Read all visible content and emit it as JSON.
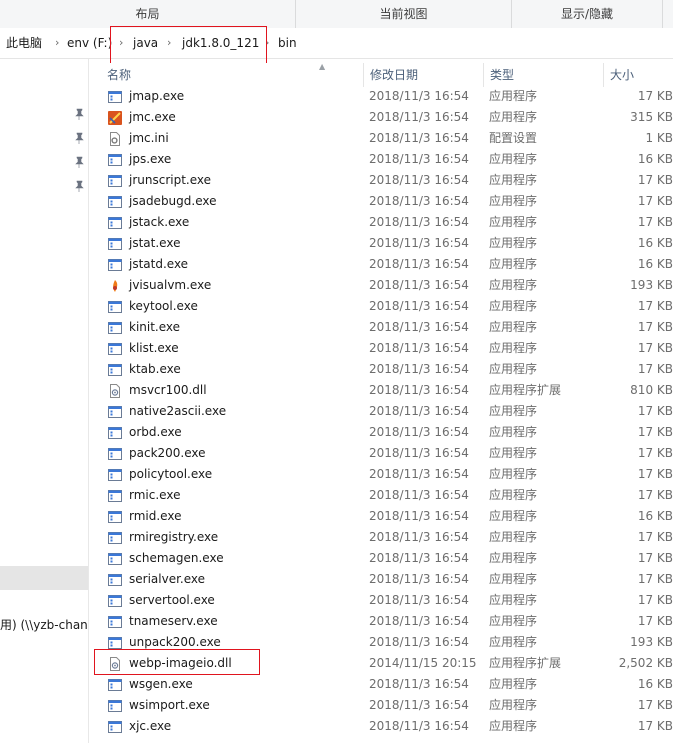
{
  "ribbon": {
    "sections": [
      "布局",
      "当前视图",
      "显示/隐藏"
    ]
  },
  "address": {
    "crumbs": [
      "此电脑",
      "env (F:)",
      "java",
      "jdk1.8.0_121",
      "bin"
    ]
  },
  "nav": {
    "network_label": "用) (\\\\yzb-chan"
  },
  "columns": {
    "name": "名称",
    "date": "修改日期",
    "type": "类型",
    "size": "大小"
  },
  "files": [
    {
      "name": "jmap.exe",
      "date": "2018/11/3 16:54",
      "type": "应用程序",
      "size": "17 KB",
      "icon": "exe-icon"
    },
    {
      "name": "jmc.exe",
      "date": "2018/11/3 16:54",
      "type": "应用程序",
      "size": "315 KB",
      "icon": "mission-control-icon"
    },
    {
      "name": "jmc.ini",
      "date": "2018/11/3 16:54",
      "type": "配置设置",
      "size": "1 KB",
      "icon": "ini-file-icon"
    },
    {
      "name": "jps.exe",
      "date": "2018/11/3 16:54",
      "type": "应用程序",
      "size": "16 KB",
      "icon": "exe-icon"
    },
    {
      "name": "jrunscript.exe",
      "date": "2018/11/3 16:54",
      "type": "应用程序",
      "size": "17 KB",
      "icon": "exe-icon"
    },
    {
      "name": "jsadebugd.exe",
      "date": "2018/11/3 16:54",
      "type": "应用程序",
      "size": "17 KB",
      "icon": "exe-icon"
    },
    {
      "name": "jstack.exe",
      "date": "2018/11/3 16:54",
      "type": "应用程序",
      "size": "17 KB",
      "icon": "exe-icon"
    },
    {
      "name": "jstat.exe",
      "date": "2018/11/3 16:54",
      "type": "应用程序",
      "size": "16 KB",
      "icon": "exe-icon"
    },
    {
      "name": "jstatd.exe",
      "date": "2018/11/3 16:54",
      "type": "应用程序",
      "size": "16 KB",
      "icon": "exe-icon"
    },
    {
      "name": "jvisualvm.exe",
      "date": "2018/11/3 16:54",
      "type": "应用程序",
      "size": "193 KB",
      "icon": "visualvm-icon"
    },
    {
      "name": "keytool.exe",
      "date": "2018/11/3 16:54",
      "type": "应用程序",
      "size": "17 KB",
      "icon": "exe-icon"
    },
    {
      "name": "kinit.exe",
      "date": "2018/11/3 16:54",
      "type": "应用程序",
      "size": "17 KB",
      "icon": "exe-icon"
    },
    {
      "name": "klist.exe",
      "date": "2018/11/3 16:54",
      "type": "应用程序",
      "size": "17 KB",
      "icon": "exe-icon"
    },
    {
      "name": "ktab.exe",
      "date": "2018/11/3 16:54",
      "type": "应用程序",
      "size": "17 KB",
      "icon": "exe-icon"
    },
    {
      "name": "msvcr100.dll",
      "date": "2018/11/3 16:54",
      "type": "应用程序扩展",
      "size": "810 KB",
      "icon": "dll-icon"
    },
    {
      "name": "native2ascii.exe",
      "date": "2018/11/3 16:54",
      "type": "应用程序",
      "size": "17 KB",
      "icon": "exe-icon"
    },
    {
      "name": "orbd.exe",
      "date": "2018/11/3 16:54",
      "type": "应用程序",
      "size": "17 KB",
      "icon": "exe-icon"
    },
    {
      "name": "pack200.exe",
      "date": "2018/11/3 16:54",
      "type": "应用程序",
      "size": "17 KB",
      "icon": "exe-icon"
    },
    {
      "name": "policytool.exe",
      "date": "2018/11/3 16:54",
      "type": "应用程序",
      "size": "17 KB",
      "icon": "exe-icon"
    },
    {
      "name": "rmic.exe",
      "date": "2018/11/3 16:54",
      "type": "应用程序",
      "size": "17 KB",
      "icon": "exe-icon"
    },
    {
      "name": "rmid.exe",
      "date": "2018/11/3 16:54",
      "type": "应用程序",
      "size": "16 KB",
      "icon": "exe-icon"
    },
    {
      "name": "rmiregistry.exe",
      "date": "2018/11/3 16:54",
      "type": "应用程序",
      "size": "17 KB",
      "icon": "exe-icon"
    },
    {
      "name": "schemagen.exe",
      "date": "2018/11/3 16:54",
      "type": "应用程序",
      "size": "17 KB",
      "icon": "exe-icon"
    },
    {
      "name": "serialver.exe",
      "date": "2018/11/3 16:54",
      "type": "应用程序",
      "size": "17 KB",
      "icon": "exe-icon"
    },
    {
      "name": "servertool.exe",
      "date": "2018/11/3 16:54",
      "type": "应用程序",
      "size": "17 KB",
      "icon": "exe-icon"
    },
    {
      "name": "tnameserv.exe",
      "date": "2018/11/3 16:54",
      "type": "应用程序",
      "size": "17 KB",
      "icon": "exe-icon"
    },
    {
      "name": "unpack200.exe",
      "date": "2018/11/3 16:54",
      "type": "应用程序",
      "size": "193 KB",
      "icon": "exe-icon"
    },
    {
      "name": "webp-imageio.dll",
      "date": "2014/11/15 20:15",
      "type": "应用程序扩展",
      "size": "2,502 KB",
      "icon": "dll-icon"
    },
    {
      "name": "wsgen.exe",
      "date": "2018/11/3 16:54",
      "type": "应用程序",
      "size": "16 KB",
      "icon": "exe-icon"
    },
    {
      "name": "wsimport.exe",
      "date": "2018/11/3 16:54",
      "type": "应用程序",
      "size": "17 KB",
      "icon": "exe-icon"
    },
    {
      "name": "xjc.exe",
      "date": "2018/11/3 16:54",
      "type": "应用程序",
      "size": "17 KB",
      "icon": "exe-icon"
    }
  ],
  "colors": {
    "highlight": "#e0141e",
    "header_text": "#4c607a",
    "secondary_text": "#6d6d6d"
  }
}
